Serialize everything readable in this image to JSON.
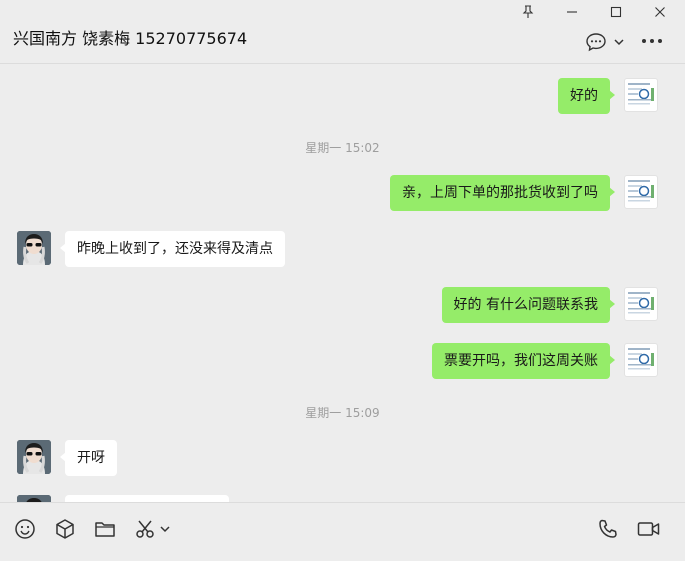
{
  "window": {
    "controls": {
      "pin_icon": "pin-icon",
      "minimize_icon": "minimize-icon",
      "maximize_icon": "maximize-icon",
      "close_icon": "close-icon"
    }
  },
  "header": {
    "title": "兴国南方 饶素梅 15270775674",
    "icons": [
      "chat-bubble-icon",
      "chevron-down-icon",
      "more-icon"
    ]
  },
  "messages": [
    {
      "type": "message",
      "from": "me",
      "text": "好的"
    },
    {
      "type": "time",
      "text": "星期一 15:02"
    },
    {
      "type": "message",
      "from": "me",
      "text": "亲，上周下单的那批货收到了吗"
    },
    {
      "type": "message",
      "from": "other",
      "text": "昨晚上收到了，还没来得及清点"
    },
    {
      "type": "message",
      "from": "me",
      "text": "好的 有什么问题联系我"
    },
    {
      "type": "message",
      "from": "me",
      "text": "票要开吗，我们这周关账"
    },
    {
      "type": "time",
      "text": "星期一 15:09"
    },
    {
      "type": "message",
      "from": "other",
      "text": "开呀"
    }
  ],
  "toolbar": {
    "left": [
      "emoji-icon",
      "package-icon",
      "folder-icon",
      "scissors-icon",
      "chevron-down-icon"
    ],
    "right": [
      "phone-icon",
      "video-icon"
    ]
  },
  "colors": {
    "background": "#ededed",
    "my_bubble": "#95ec69",
    "other_bubble": "#ffffff",
    "time_text": "#9e9e9e"
  }
}
